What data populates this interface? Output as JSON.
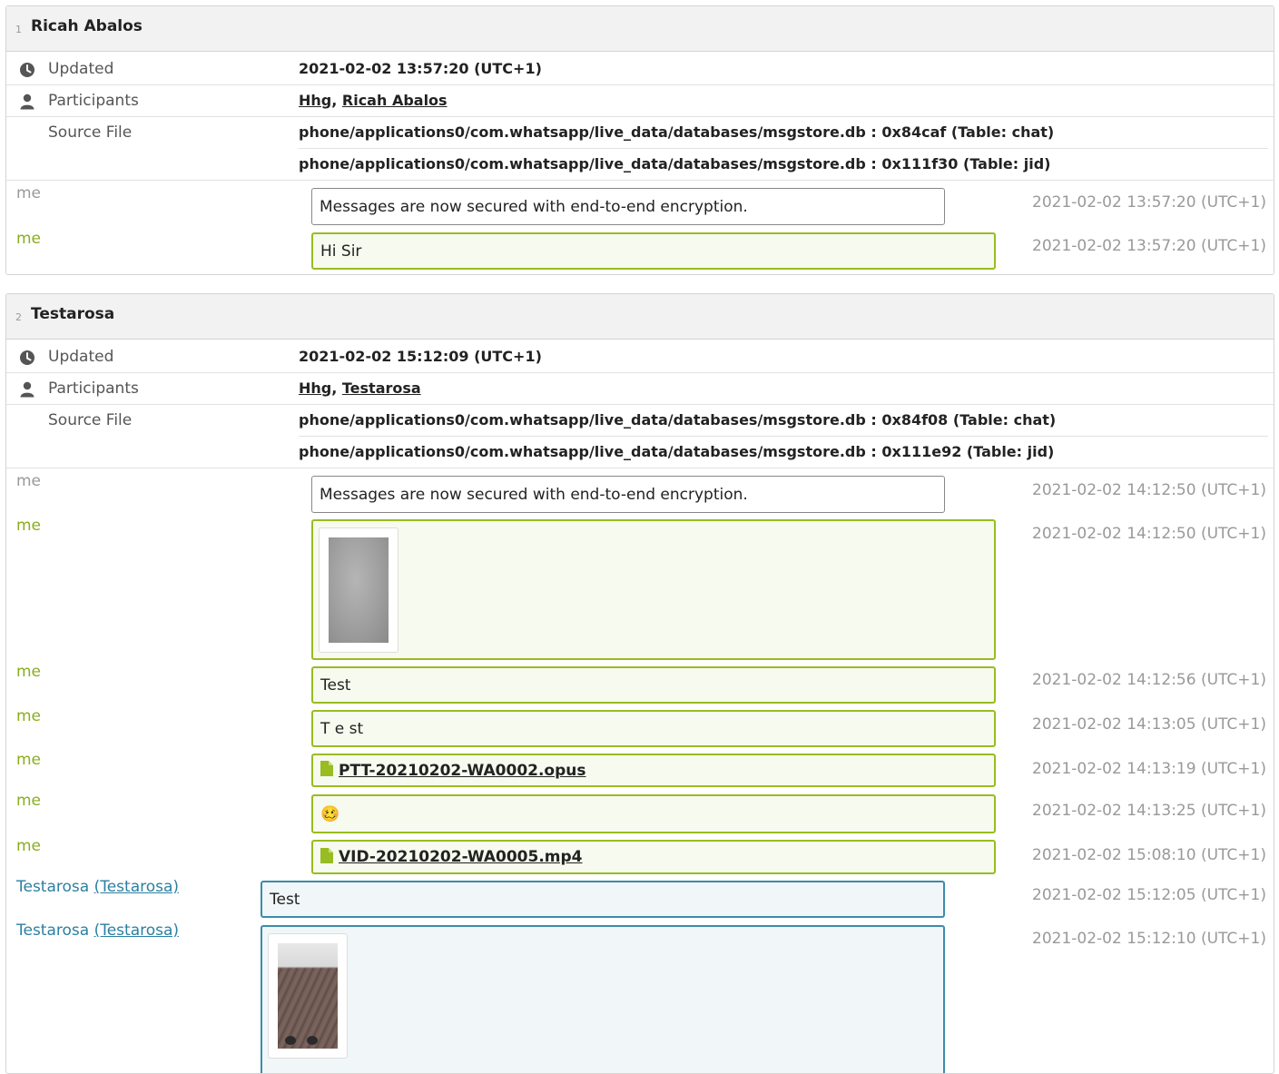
{
  "chats": [
    {
      "index": "1",
      "title": "Ricah Abalos",
      "updated_label": "Updated",
      "updated_value": "2021-02-02 13:57:20 (UTC+1)",
      "participants_label": "Participants",
      "participants": [
        "Hhg",
        "Ricah Abalos"
      ],
      "source_label": "Source File",
      "sources": [
        "phone/applications0/com.whatsapp/live_data/databases/msgstore.db : 0x84caf (Table: chat)",
        "phone/applications0/com.whatsapp/live_data/databases/msgstore.db : 0x111f30 (Table: jid)"
      ],
      "messages": [
        {
          "sender": "me",
          "text": "Messages are now secured with end-to-end encryption.",
          "time": "2021-02-02 13:57:20 (UTC+1)"
        },
        {
          "sender": "me",
          "text": "Hi Sir",
          "time": "2021-02-02 13:57:20 (UTC+1)"
        }
      ]
    },
    {
      "index": "2",
      "title": "Testarosa",
      "updated_label": "Updated",
      "updated_value": "2021-02-02 15:12:09 (UTC+1)",
      "participants_label": "Participants",
      "participants": [
        "Hhg",
        "Testarosa"
      ],
      "source_label": "Source File",
      "sources": [
        "phone/applications0/com.whatsapp/live_data/databases/msgstore.db : 0x84f08 (Table: chat)",
        "phone/applications0/com.whatsapp/live_data/databases/msgstore.db : 0x111e92 (Table: jid)"
      ],
      "messages": [
        {
          "sender": "me",
          "text": "Messages are now secured with end-to-end encryption.",
          "time": "2021-02-02 14:12:50 (UTC+1)"
        },
        {
          "sender": "me",
          "text": "",
          "time": "2021-02-02 14:12:50 (UTC+1)"
        },
        {
          "sender": "me",
          "text": "Test",
          "time": "2021-02-02 14:12:56 (UTC+1)"
        },
        {
          "sender": "me",
          "text": "T e st",
          "time": "2021-02-02 14:13:05 (UTC+1)"
        },
        {
          "sender": "me",
          "text": "PTT-20210202-WA0002.opus",
          "time": "2021-02-02 14:13:19 (UTC+1)"
        },
        {
          "sender": "me",
          "text": "🥴",
          "time": "2021-02-02 14:13:25 (UTC+1)"
        },
        {
          "sender": "me",
          "text": "VID-20210202-WA0005.mp4",
          "time": "2021-02-02 15:08:10 (UTC+1)"
        },
        {
          "sender": "Testarosa",
          "sender_link": "(Testarosa)",
          "text": "Test",
          "time": "2021-02-02 15:12:05 (UTC+1)"
        },
        {
          "sender": "Testarosa",
          "sender_link": "(Testarosa)",
          "text": "",
          "time": "2021-02-02 15:12:10 (UTC+1)"
        }
      ]
    }
  ],
  "colors": {
    "me_accent": "#98bc21",
    "other_accent": "#3c8bab",
    "header_bg": "#f2f2f2"
  },
  "icons": {
    "updated": "clock-icon",
    "participants": "person-icon",
    "attachment": "file-icon"
  }
}
